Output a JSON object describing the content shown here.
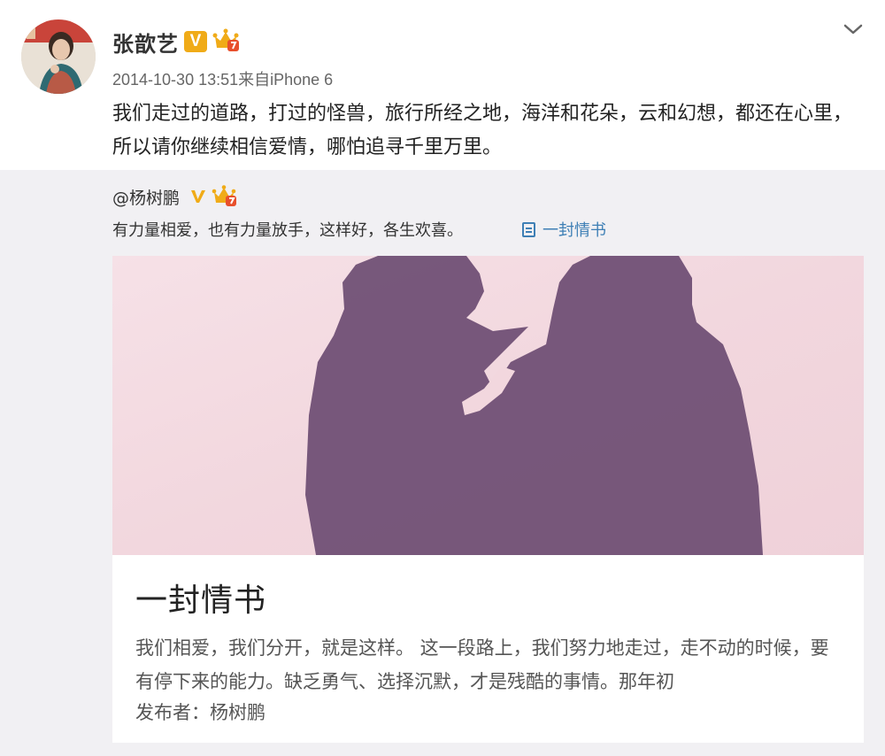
{
  "post": {
    "author": "张歆艺",
    "verified_badge": "V",
    "timestamp": "2014-10-30 13:51",
    "source": "来自iPhone 6",
    "text": "我们走过的道路，打过的怪兽，旅行所经之地，海洋和花朵，云和幻想，都还在心里，所以请你继续相信爱情，哪怕追寻千里万里。",
    "icons": [
      "avatar",
      "verified-v-icon",
      "vip-crown-icon",
      "chevron-down-icon"
    ]
  },
  "repost": {
    "author": "@杨树鹏",
    "text": "有力量相爱，也有力量放手，这样好，各生欢喜。",
    "link_label": "一封情书",
    "icons": [
      "verified-v-icon",
      "vip-crown-icon",
      "article-icon"
    ]
  },
  "card": {
    "title": "一封情书",
    "description": "我们相爱，我们分开，就是这样。 这一段路上，我们努力地走过，走不动的时候，要有停下来的能力。缺乏勇气、选择沉默，才是残酷的事情。那年初",
    "publisher": "发布者：杨树鹏"
  },
  "colors": {
    "link": "#3e7fb5",
    "badge_gold": "#f0ab18",
    "repost_bg": "#f1f0f3",
    "image_pink": "#f3d8df",
    "shadow_purple": "#6a4a70"
  }
}
